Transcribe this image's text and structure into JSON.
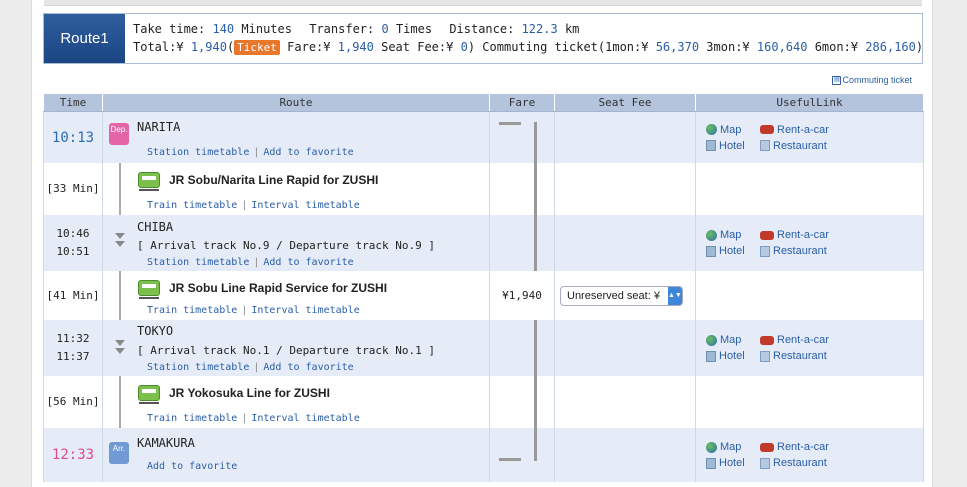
{
  "route": {
    "label": "Route1",
    "take_time_label": "Take time:",
    "take_time_value": "140",
    "take_time_unit": "Minutes",
    "transfer_label": "Transfer:",
    "transfer_value": "0",
    "transfer_unit": "Times",
    "distance_label": "Distance:",
    "distance_value": "122.3",
    "distance_unit": "km",
    "total_label": "Total:¥",
    "total_value": "1,940",
    "total_open": "(",
    "ticket_badge": "Ticket",
    "fare_label": "Fare:¥",
    "fare_value": "1,940",
    "seat_fee_label": "Seat Fee:¥",
    "seat_fee_value": "0",
    "seat_fee_close": ")",
    "commuting_label": "Commuting ticket(1mon:¥",
    "mon1_value": "56,370",
    "mon3_label": "3mon:¥",
    "mon3_value": "160,640",
    "mon6_label": "6mon:¥",
    "mon6_value": "286,160",
    "commuting_close": ")"
  },
  "commuting_link": {
    "icon": "ticket-icon",
    "label": "Commuting ticket"
  },
  "columns": [
    "Time",
    "Route",
    "Fare",
    "Seat Fee",
    "UsefulLink"
  ],
  "links": {
    "station_timetable": "Station timetable",
    "add_to_favorite": "Add to favorite",
    "train_timetable": "Train timetable",
    "interval_timetable": "Interval timetable",
    "separator": "|"
  },
  "useful": {
    "map": "Map",
    "rent": "Rent-a-car",
    "hotel": "Hotel",
    "restaurant": "Restaurant"
  },
  "stations": [
    {
      "time": "10:13",
      "badge": "Dep.",
      "name": "NARITA"
    },
    {
      "time1": "10:46",
      "time2": "10:51",
      "name": "CHIBA",
      "track": "[ Arrival track No.9 / Departure track No.9 ]"
    },
    {
      "time1": "11:32",
      "time2": "11:37",
      "name": "TOKYO",
      "track": "[ Arrival track No.1 / Departure track No.1 ]"
    },
    {
      "time": "12:33",
      "badge": "Arr.",
      "name": "KAMAKURA"
    }
  ],
  "segments": [
    {
      "duration": "[33 Min]",
      "line": "JR Sobu/Narita Line Rapid  for ZUSHI"
    },
    {
      "duration": "[41 Min]",
      "line": "JR Sobu Line Rapid Service  for ZUSHI",
      "fare": "¥1,940",
      "seat": "Unreserved seat: ¥"
    },
    {
      "duration": "[56 Min]",
      "line": "JR Yokosuka Line  for ZUSHI"
    }
  ],
  "colors": {
    "accent": "#2b5ea7",
    "header_bg": "#b3c4dc",
    "dep_badge": "#e365a7",
    "arr_badge": "#6f9ad4",
    "ticket": "#e8762b"
  }
}
